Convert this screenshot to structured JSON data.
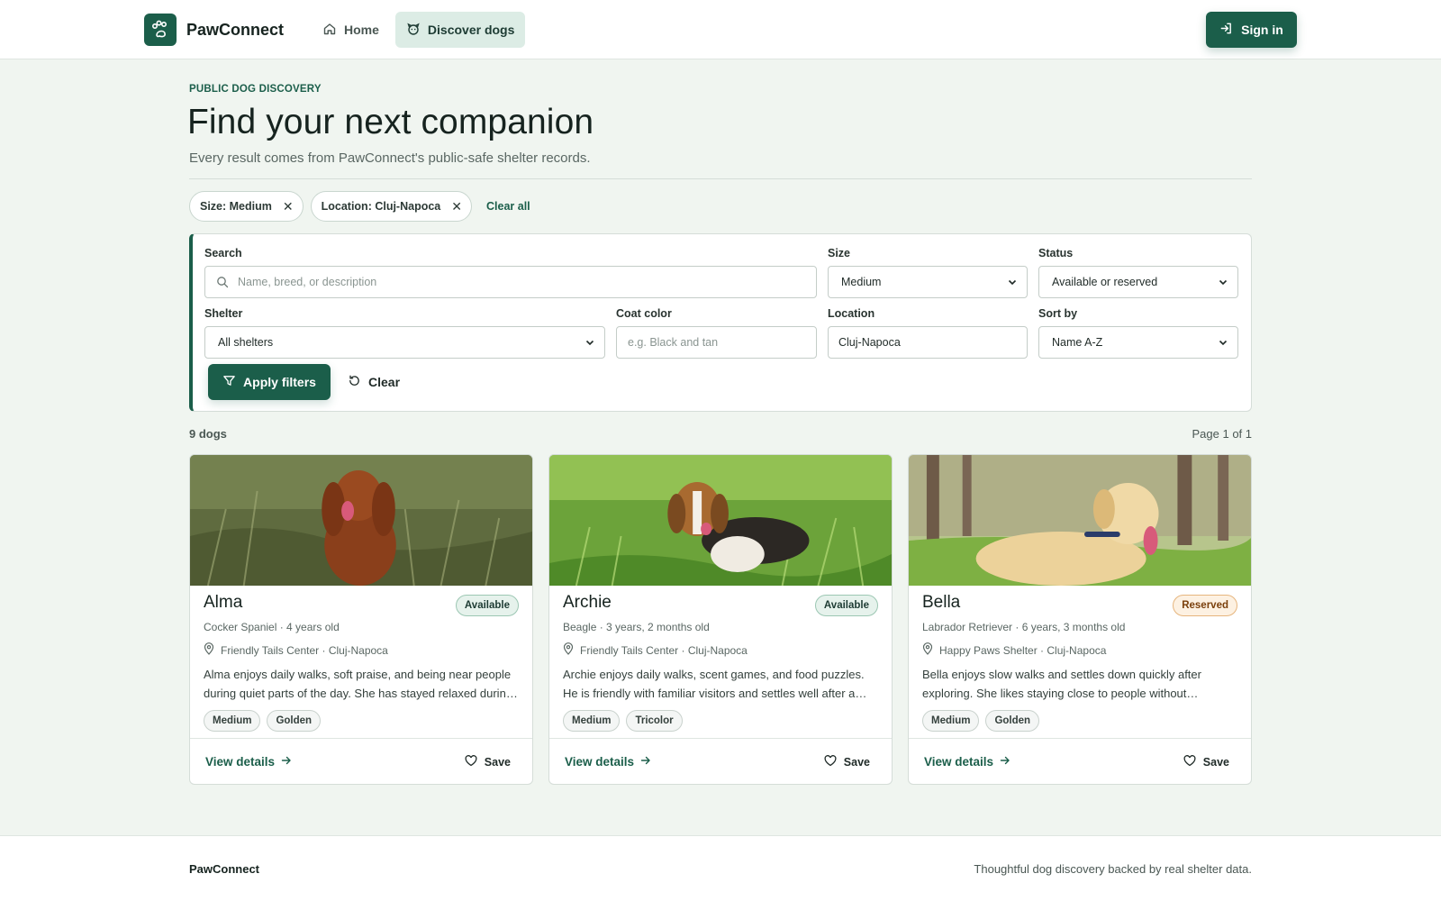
{
  "header": {
    "brand": "PawConnect",
    "nav": [
      {
        "label": "Home",
        "icon": "home-icon",
        "active": false
      },
      {
        "label": "Discover dogs",
        "icon": "dog-icon",
        "active": true
      }
    ],
    "signin_label": "Sign in"
  },
  "hero": {
    "eyebrow": "PUBLIC DOG DISCOVERY",
    "title": "Find your next companion",
    "subtitle": "Every result comes from PawConnect's public-safe shelter records."
  },
  "active_filters": {
    "chips": [
      "Size: Medium",
      "Location: Cluj-Napoca"
    ],
    "clear_all": "Clear all"
  },
  "filters": {
    "search": {
      "label": "Search",
      "placeholder": "Name, breed, or description",
      "value": ""
    },
    "size": {
      "label": "Size",
      "value": "Medium"
    },
    "status": {
      "label": "Status",
      "value": "Available or reserved"
    },
    "shelter": {
      "label": "Shelter",
      "value": "All shelters"
    },
    "coat_color": {
      "label": "Coat color",
      "placeholder": "e.g. Black and tan",
      "value": ""
    },
    "location": {
      "label": "Location",
      "value": "Cluj-Napoca"
    },
    "sort": {
      "label": "Sort by",
      "value": "Name A-Z"
    },
    "apply_label": "Apply filters",
    "clear_label": "Clear"
  },
  "results": {
    "count": "9 dogs",
    "page": "Page 1 of 1"
  },
  "dogs": [
    {
      "name": "Alma",
      "status": "Available",
      "meta": "Cocker Spaniel · 4 years old",
      "location": "Friendly Tails Center · Cluj-Napoca",
      "description": "Alma enjoys daily walks, soft praise, and being near people during quiet parts of the day. She has stayed relaxed during short visits and gentle handling.",
      "tags": [
        "Medium",
        "Golden"
      ],
      "view_label": "View details",
      "save_label": "Save"
    },
    {
      "name": "Archie",
      "status": "Available",
      "meta": "Beagle · 3 years, 2 months old",
      "location": "Friendly Tails Center · Cluj-Napoca",
      "description": "Archie enjoys daily walks, scent games, and food puzzles. He is friendly with familiar visitors and settles well after a busy walk outdoors.",
      "tags": [
        "Medium",
        "Tricolor"
      ],
      "view_label": "View details",
      "save_label": "Save"
    },
    {
      "name": "Bella",
      "status": "Reserved",
      "meta": "Labrador Retriever · 6 years, 3 months old",
      "location": "Happy Paws Shelter · Cluj-Napoca",
      "description": "Bella enjoys slow walks and settles down quickly after exploring. She likes staying close to people without demanding constant attention.",
      "tags": [
        "Medium",
        "Golden"
      ],
      "view_label": "View details",
      "save_label": "Save"
    }
  ],
  "footer": {
    "brand": "PawConnect",
    "tagline": "Thoughtful dog discovery backed by real shelter data."
  },
  "colors": {
    "primary": "#1b5e4a",
    "page_bg": "#f0f5f0",
    "available_bg": "#e6f2ec",
    "reserved_bg": "#fdf1e2"
  }
}
